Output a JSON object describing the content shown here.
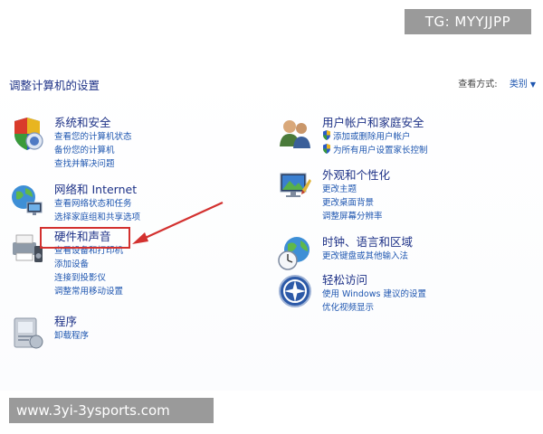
{
  "page": {
    "title": "调整计算机的设置",
    "view_by_label": "查看方式:",
    "view_by_value": "类别"
  },
  "categories_left": [
    {
      "title": "系统和安全",
      "icon": "shield-icon",
      "links": [
        "查看您的计算机状态",
        "备份您的计算机",
        "查找并解决问题"
      ]
    },
    {
      "title": "网络和 Internet",
      "icon": "network-globe-icon",
      "links": [
        "查看网络状态和任务",
        "选择家庭组和共享选项"
      ]
    },
    {
      "title": "硬件和声音",
      "icon": "printer-speaker-icon",
      "links": [
        "查看设备和打印机",
        "添加设备",
        "连接到投影仪",
        "调整常用移动设置"
      ]
    },
    {
      "title": "程序",
      "icon": "programs-icon",
      "links": [
        "卸载程序"
      ]
    }
  ],
  "categories_right": [
    {
      "title": "用户帐户和家庭安全",
      "icon": "users-icon",
      "links": [
        "添加或删除用户帐户",
        "为所有用户设置家长控制"
      ]
    },
    {
      "title": "外观和个性化",
      "icon": "appearance-icon",
      "links": [
        "更改主题",
        "更改桌面背景",
        "调整屏幕分辨率"
      ]
    },
    {
      "title": "时钟、语言和区域",
      "icon": "clock-globe-icon",
      "links": [
        "更改键盘或其他输入法"
      ]
    },
    {
      "title": "轻松访问",
      "icon": "ease-of-access-icon",
      "links": [
        "使用 Windows 建议的设置",
        "优化视频显示"
      ]
    }
  ],
  "watermarks": {
    "top": "TG: MYYJJPP",
    "bottom": "www.3yi-3ysports.com"
  },
  "colors": {
    "title_blue": "#1e3287",
    "link_blue": "#1e56b0",
    "highlight_red": "#d3312f"
  }
}
